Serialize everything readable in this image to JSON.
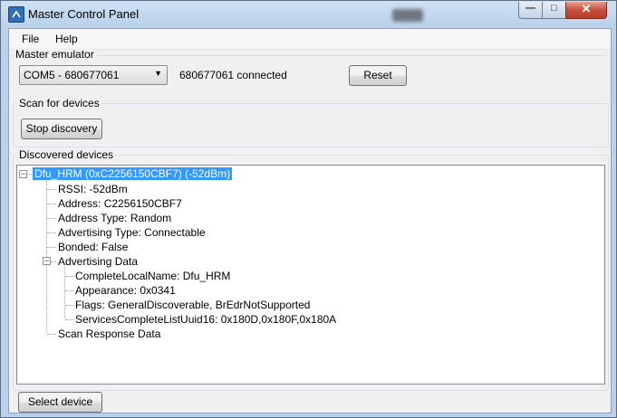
{
  "window": {
    "title": "Master Control Panel",
    "controls": {
      "minimize": "—",
      "maximize": "□",
      "close": "✕"
    }
  },
  "menu": {
    "file": "File",
    "help": "Help"
  },
  "master_emulator": {
    "label": "Master emulator",
    "selected_port": "COM5 - 680677061",
    "status": "680677061 connected",
    "reset_label": "Reset"
  },
  "scan": {
    "label": "Scan for devices",
    "stop_label": "Stop discovery"
  },
  "discovered": {
    "label": "Discovered devices",
    "root": "Dfu_HRM (0xC2256150CBF7) (-52dBm)",
    "props": [
      "RSSI: -52dBm",
      "Address: C2256150CBF7",
      "Address Type: Random",
      "Advertising Type: Connectable",
      "Bonded: False",
      "Advertising Data"
    ],
    "adv_children": [
      "CompleteLocalName: Dfu_HRM",
      "Appearance: 0x0341",
      "Flags: GeneralDiscoverable, BrEdrNotSupported",
      "ServicesCompleteListUuid16: 0x180D,0x180F,0x180A"
    ],
    "scan_response": "Scan Response Data"
  },
  "select_device_label": "Select device",
  "icons": {
    "app": "app-icon",
    "combo_arrow": "chevron-down-icon"
  }
}
